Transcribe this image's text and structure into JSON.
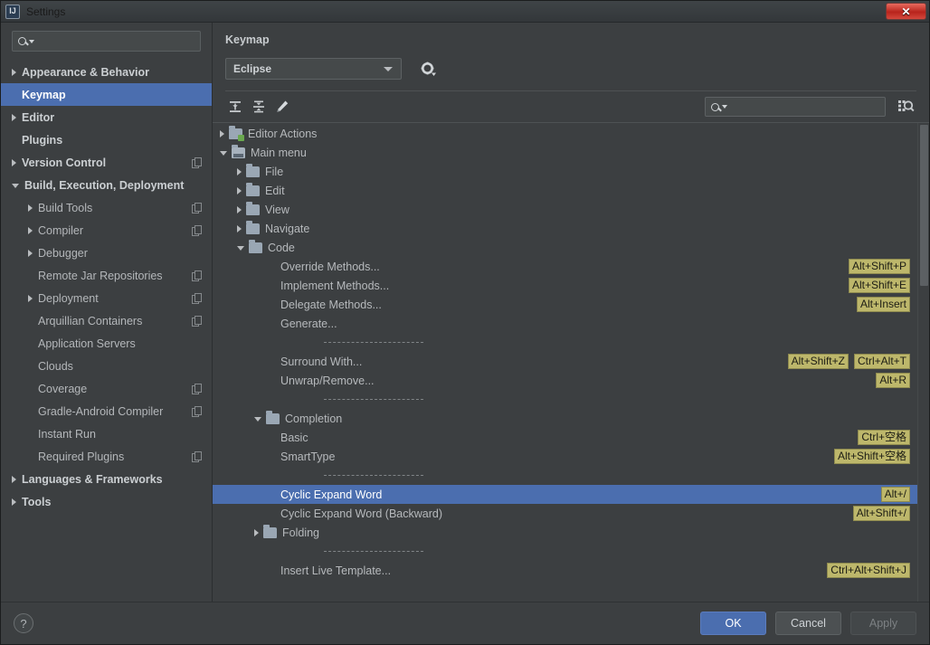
{
  "window": {
    "title": "Settings",
    "app_icon": "intellij-idea-icon",
    "close_label": "✕"
  },
  "sidebar": {
    "search": {
      "placeholder": "",
      "value": "",
      "icon": "search-icon"
    },
    "items": [
      {
        "label": "Appearance & Behavior",
        "indent": 0,
        "arrow": "right",
        "bold": true,
        "selected": false,
        "copy": false
      },
      {
        "label": "Keymap",
        "indent": 0,
        "arrow": "none",
        "bold": true,
        "selected": true,
        "copy": false
      },
      {
        "label": "Editor",
        "indent": 0,
        "arrow": "right",
        "bold": true,
        "selected": false,
        "copy": false
      },
      {
        "label": "Plugins",
        "indent": 0,
        "arrow": "none",
        "bold": true,
        "selected": false,
        "copy": false
      },
      {
        "label": "Version Control",
        "indent": 0,
        "arrow": "right",
        "bold": true,
        "selected": false,
        "copy": true
      },
      {
        "label": "Build, Execution, Deployment",
        "indent": 0,
        "arrow": "down",
        "bold": true,
        "selected": false,
        "copy": false
      },
      {
        "label": "Build Tools",
        "indent": 1,
        "arrow": "right",
        "bold": false,
        "selected": false,
        "copy": true
      },
      {
        "label": "Compiler",
        "indent": 1,
        "arrow": "right",
        "bold": false,
        "selected": false,
        "copy": true
      },
      {
        "label": "Debugger",
        "indent": 1,
        "arrow": "right",
        "bold": false,
        "selected": false,
        "copy": false
      },
      {
        "label": "Remote Jar Repositories",
        "indent": 1,
        "arrow": "none",
        "bold": false,
        "selected": false,
        "copy": true
      },
      {
        "label": "Deployment",
        "indent": 1,
        "arrow": "right",
        "bold": false,
        "selected": false,
        "copy": true
      },
      {
        "label": "Arquillian Containers",
        "indent": 1,
        "arrow": "none",
        "bold": false,
        "selected": false,
        "copy": true
      },
      {
        "label": "Application Servers",
        "indent": 1,
        "arrow": "none",
        "bold": false,
        "selected": false,
        "copy": false
      },
      {
        "label": "Clouds",
        "indent": 1,
        "arrow": "none",
        "bold": false,
        "selected": false,
        "copy": false
      },
      {
        "label": "Coverage",
        "indent": 1,
        "arrow": "none",
        "bold": false,
        "selected": false,
        "copy": true
      },
      {
        "label": "Gradle-Android Compiler",
        "indent": 1,
        "arrow": "none",
        "bold": false,
        "selected": false,
        "copy": true
      },
      {
        "label": "Instant Run",
        "indent": 1,
        "arrow": "none",
        "bold": false,
        "selected": false,
        "copy": false
      },
      {
        "label": "Required Plugins",
        "indent": 1,
        "arrow": "none",
        "bold": false,
        "selected": false,
        "copy": true
      },
      {
        "label": "Languages & Frameworks",
        "indent": 0,
        "arrow": "right",
        "bold": true,
        "selected": false,
        "copy": false
      },
      {
        "label": "Tools",
        "indent": 0,
        "arrow": "right",
        "bold": true,
        "selected": false,
        "copy": false
      }
    ]
  },
  "main": {
    "title": "Keymap",
    "scheme": {
      "value": "Eclipse",
      "gear_icon": "gear-icon"
    },
    "toolbar": {
      "expand_all_icon": "expand-all-icon",
      "collapse_all_icon": "collapse-all-icon",
      "edit_shortcut_icon": "pencil-icon",
      "find_placeholder": "",
      "find_value": "",
      "find_icon": "search-icon",
      "find_by_shortcut_icon": "find-by-shortcut-icon"
    },
    "tree": [
      {
        "label": "Editor Actions",
        "indent": 0,
        "arrow": "right",
        "icon": "folder-green",
        "type": "node",
        "shortcuts": []
      },
      {
        "label": "Main menu",
        "indent": 0,
        "arrow": "down",
        "icon": "folder-menu",
        "type": "node",
        "shortcuts": []
      },
      {
        "label": "File",
        "indent": 1,
        "arrow": "right",
        "icon": "folder",
        "type": "node",
        "shortcuts": []
      },
      {
        "label": "Edit",
        "indent": 1,
        "arrow": "right",
        "icon": "folder",
        "type": "node",
        "shortcuts": []
      },
      {
        "label": "View",
        "indent": 1,
        "arrow": "right",
        "icon": "folder",
        "type": "node",
        "shortcuts": []
      },
      {
        "label": "Navigate",
        "indent": 1,
        "arrow": "right",
        "icon": "folder",
        "type": "node",
        "shortcuts": []
      },
      {
        "label": "Code",
        "indent": 1,
        "arrow": "down",
        "icon": "folder",
        "type": "node",
        "shortcuts": []
      },
      {
        "label": "Override Methods...",
        "indent": 3,
        "arrow": "none",
        "icon": "none",
        "type": "action",
        "shortcuts": [
          "Alt+Shift+P"
        ]
      },
      {
        "label": "Implement Methods...",
        "indent": 3,
        "arrow": "none",
        "icon": "none",
        "type": "action",
        "shortcuts": [
          "Alt+Shift+E"
        ]
      },
      {
        "label": "Delegate Methods...",
        "indent": 3,
        "arrow": "none",
        "icon": "none",
        "type": "action",
        "shortcuts": [
          "Alt+Insert"
        ]
      },
      {
        "label": "Generate...",
        "indent": 3,
        "arrow": "none",
        "icon": "none",
        "type": "action",
        "shortcuts": []
      },
      {
        "label": "",
        "indent": 3,
        "arrow": "none",
        "icon": "none",
        "type": "separator",
        "shortcuts": []
      },
      {
        "label": "Surround With...",
        "indent": 3,
        "arrow": "none",
        "icon": "none",
        "type": "action",
        "shortcuts": [
          "Alt+Shift+Z",
          "Ctrl+Alt+T"
        ]
      },
      {
        "label": "Unwrap/Remove...",
        "indent": 3,
        "arrow": "none",
        "icon": "none",
        "type": "action",
        "shortcuts": [
          "Alt+R"
        ]
      },
      {
        "label": "",
        "indent": 3,
        "arrow": "none",
        "icon": "none",
        "type": "separator",
        "shortcuts": []
      },
      {
        "label": "Completion",
        "indent": 2,
        "arrow": "down",
        "icon": "folder",
        "type": "node",
        "shortcuts": []
      },
      {
        "label": "Basic",
        "indent": 3,
        "arrow": "none",
        "icon": "none",
        "type": "action",
        "shortcuts": [
          "Ctrl+空格"
        ]
      },
      {
        "label": "SmartType",
        "indent": 3,
        "arrow": "none",
        "icon": "none",
        "type": "action",
        "shortcuts": [
          "Alt+Shift+空格"
        ]
      },
      {
        "label": "",
        "indent": 3,
        "arrow": "none",
        "icon": "none",
        "type": "separator",
        "shortcuts": []
      },
      {
        "label": "Cyclic Expand Word",
        "indent": 3,
        "arrow": "none",
        "icon": "none",
        "type": "action",
        "selected": true,
        "shortcuts": [
          "Alt+/"
        ]
      },
      {
        "label": "Cyclic Expand Word (Backward)",
        "indent": 3,
        "arrow": "none",
        "icon": "none",
        "type": "action",
        "shortcuts": [
          "Alt+Shift+/"
        ]
      },
      {
        "label": "Folding",
        "indent": 2,
        "arrow": "right",
        "icon": "folder",
        "type": "node",
        "shortcuts": []
      },
      {
        "label": "",
        "indent": 3,
        "arrow": "none",
        "icon": "none",
        "type": "separator",
        "shortcuts": []
      },
      {
        "label": "Insert Live Template...",
        "indent": 3,
        "arrow": "none",
        "icon": "none",
        "type": "action",
        "shortcuts": [
          "Ctrl+Alt+Shift+J"
        ]
      }
    ]
  },
  "footer": {
    "help_label": "?",
    "ok_label": "OK",
    "cancel_label": "Cancel",
    "apply_label": "Apply"
  },
  "colors": {
    "selection": "#4b6eaf",
    "shortcut_badge": "#bdb76b",
    "window_bg": "#3c3f41",
    "close_button": "#c0392b"
  }
}
